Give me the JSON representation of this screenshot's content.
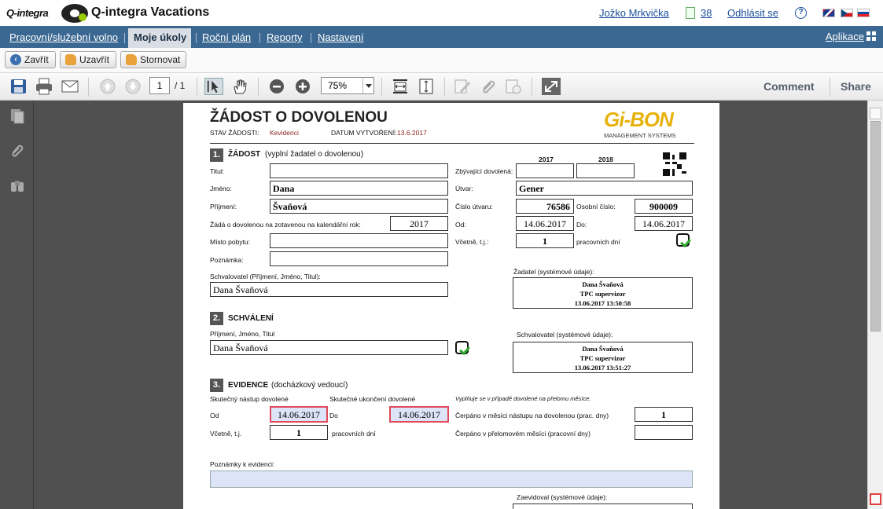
{
  "header": {
    "logo_text": "Q-integra",
    "app_title": "Q-integra Vacations",
    "user": "Jožko Mrkvička",
    "task_count": "38",
    "logout": "Odhlásit se",
    "help": "?"
  },
  "nav": {
    "items": [
      "Pracovní/služební volno",
      "Moje úkoly",
      "Roční plán",
      "Reporty",
      "Nastavení"
    ],
    "apps": "Aplikace"
  },
  "actions": {
    "close": "Zavřít",
    "lock": "Uzavřít",
    "cancel": "Stornovat"
  },
  "pdf_toolbar": {
    "page": "1",
    "page_total": "/ 1",
    "zoom": "75%",
    "comment": "Comment",
    "share": "Share"
  },
  "doc": {
    "title": "ŽÁDOST O DOVOLENOU",
    "state_label": "STAV ŽÁDOSTI:",
    "state_value": "Kevidenci",
    "created_label": "DATUM VYTVOŘENÍ:",
    "created_value": "13.6.2017",
    "brand": "Gi-BON",
    "brand_sub": "MANAGEMENT SYSTEMS",
    "sec1_num": "1.",
    "sec1_title": "ŽÁDOST",
    "sec1_sub": "(vyplní žadatel o dovolenou)",
    "titul_label": "Titul:",
    "jmeno_label": "Jméno:",
    "jmeno": "Dana",
    "prijmeni_label": "Příjmení:",
    "prijmeni": "Švaňová",
    "zada_label": "Žádá o dovolenou na zotavenou na kalendářní rok:",
    "rok": "2017",
    "misto_label": "Místo pobytu:",
    "poznamka_label": "Poznámka:",
    "schvalovatel_label": "Schvalovatel (Příjmení, Jméno, Titul):",
    "schvalovatel": "Dana Švaňová",
    "year1": "2017",
    "year2": "2018",
    "zbyvajici_label": "Zbývající dovolená:",
    "utvar_label": "Útvar:",
    "utvar": "Gener",
    "cislo_utvaru_label": "Číslo útvaru:",
    "cislo_utvaru": "76586",
    "osobni_label": "Osobní číslo:",
    "osobni": "900009",
    "od_label": "Od:",
    "od": "14.06.2017",
    "do_label": "Do:",
    "do": "14.06.2017",
    "vcetne_label": "Včetně, t.j.:",
    "vcetne": "1",
    "pracovnich": "pracovních dní",
    "zadatel_label": "Žadatel (systémové údaje):",
    "zadatel_lines": [
      "Dana Švaňová",
      "TPC supervizor",
      "13.06.2017 13:50:58"
    ],
    "sec2_num": "2.",
    "sec2_title": "SCHVÁLENÍ",
    "sec2_field_label": "Příjmení, Jméno, Titul",
    "sec2_value": "Dana Švaňová",
    "schval_sys_label": "Schvalovatel (systémové údaje):",
    "schval_lines": [
      "Dana Švaňová",
      "TPC supervizor",
      "13.06.2017 13:51:27"
    ],
    "sec3_num": "3.",
    "sec3_title": "EVIDENCE",
    "sec3_sub": "(docházkový vedoucí)",
    "nastup_label": "Skutečný nástup dovolené",
    "ukonceni_label": "Skutečné ukončení dovolené",
    "prelom_note": "Vyplňuje se v případě dovolené na přelomu měsíce.",
    "ev_od_label": "Od",
    "ev_od": "14.06.2017",
    "ev_do_label": "Do",
    "ev_do": "14.06.2017",
    "cerpano1_label": "Čerpáno v měsíci nástupu na dovolenou (prac. dny)",
    "cerpano1": "1",
    "ev_vcetne_label": "Včetně, t.j.",
    "ev_vcetne": "1",
    "ev_pracovnich": "pracovních dní",
    "cerpano2_label": "Čerpáno v přelomovém měsíci (pracovní dny)",
    "poznamky_label": "Poznámky k evidenci:",
    "zaevidoval_label": "Zaevidoval (systémové údaje):"
  }
}
